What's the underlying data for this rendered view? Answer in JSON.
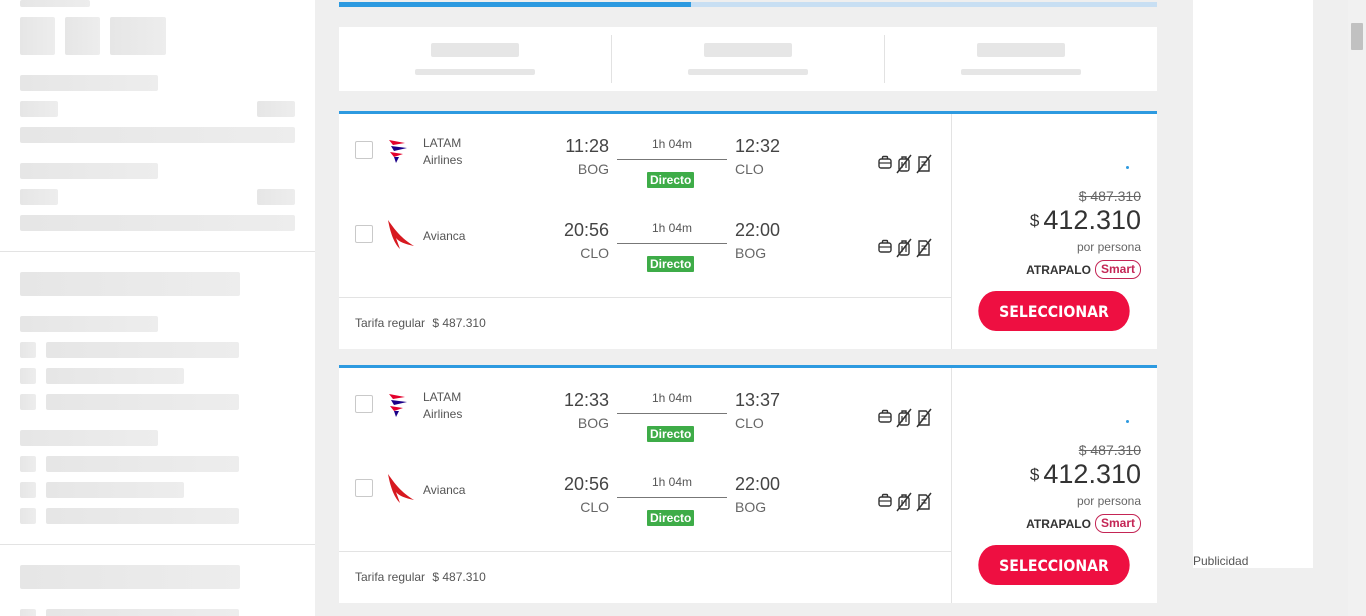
{
  "progress": {
    "fraction": 0.43
  },
  "colors": {
    "accent": "#2d9ae0",
    "select": "#ee0f41",
    "direct": "#3eac48",
    "smart": "#c42555"
  },
  "results": [
    {
      "flights": [
        {
          "airline": "LATAM Airlines",
          "airline_line1": "LATAM",
          "airline_line2": "Airlines",
          "logo": "latam-logo-icon",
          "dep_time": "11:28",
          "dep_code": "BOG",
          "duration": "1h 04m",
          "badge": "Directo",
          "arr_time": "12:32",
          "arr_code": "CLO"
        },
        {
          "airline": "Avianca",
          "airline_line1": "Avianca",
          "airline_line2": "",
          "logo": "avianca-logo-icon",
          "dep_time": "20:56",
          "dep_code": "CLO",
          "duration": "1h 04m",
          "badge": "Directo",
          "arr_time": "22:00",
          "arr_code": "BOG"
        }
      ],
      "tarifa_label": "Tarifa regular",
      "tarifa_price": "$ 487.310",
      "old_price": "$ 487.310",
      "currency": "$",
      "price": "412.310",
      "per_person": "por persona",
      "brand": "ATRAPALO",
      "smart": "Smart",
      "select_label": "SELECCIONAR"
    },
    {
      "flights": [
        {
          "airline": "LATAM Airlines",
          "airline_line1": "LATAM",
          "airline_line2": "Airlines",
          "logo": "latam-logo-icon",
          "dep_time": "12:33",
          "dep_code": "BOG",
          "duration": "1h 04m",
          "badge": "Directo",
          "arr_time": "13:37",
          "arr_code": "CLO"
        },
        {
          "airline": "Avianca",
          "airline_line1": "Avianca",
          "airline_line2": "",
          "logo": "avianca-logo-icon",
          "dep_time": "20:56",
          "dep_code": "CLO",
          "duration": "1h 04m",
          "badge": "Directo",
          "arr_time": "22:00",
          "arr_code": "BOG"
        }
      ],
      "tarifa_label": "Tarifa regular",
      "tarifa_price": "$ 487.310",
      "old_price": "$ 487.310",
      "currency": "$",
      "price": "412.310",
      "per_person": "por persona",
      "brand": "ATRAPALO",
      "smart": "Smart",
      "select_label": "SELECCIONAR"
    }
  ],
  "amenity_icons": [
    "carry-on-bag-icon",
    "no-checked-bag-icon",
    "no-change-icon"
  ],
  "ad": {
    "label": "Publicidad"
  }
}
